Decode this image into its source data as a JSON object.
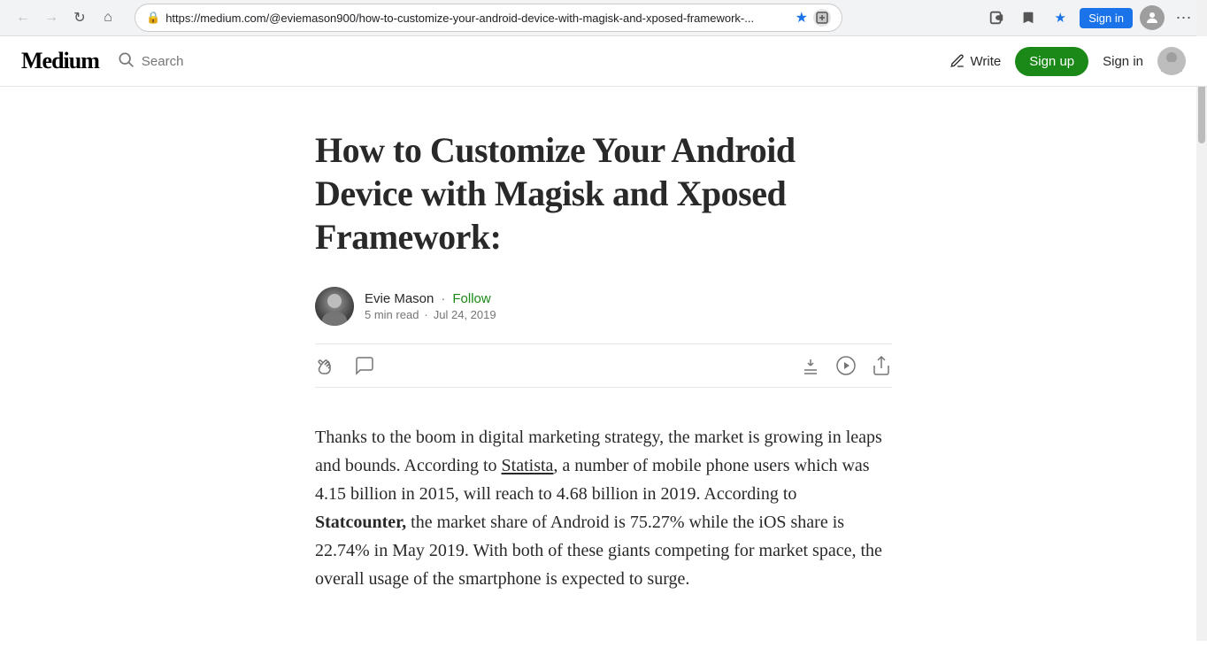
{
  "browser": {
    "url": "https://medium.com/@eviemason900/how-to-customize-your-android-device-with-magisk-and-xposed-framework-...",
    "back_btn": "←",
    "forward_btn": "→",
    "reload_btn": "↻",
    "home_btn": "⌂",
    "lock_icon": "🔒",
    "bookmark_icon": "★",
    "extensions_icon": "🧩",
    "read_list_icon": "📖",
    "star_icon": "★",
    "signin_label": "Sign in",
    "more_icon": "⋯",
    "cursor_tooltip": "cursor"
  },
  "nav": {
    "logo": "Medium",
    "search_label": "Search",
    "write_label": "Write",
    "signup_label": "Sign up",
    "signin_label": "Sign in"
  },
  "article": {
    "title": "How to Customize Your Android Device with Magisk and Xposed Framework:",
    "author": {
      "name": "Evie Mason",
      "follow_label": "Follow",
      "read_time": "5 min read",
      "dot": "·",
      "date": "Jul 24, 2019"
    },
    "actions": {
      "clap_icon": "👏",
      "comment_icon": "💬",
      "save_icon": "🔖",
      "listen_icon": "▶",
      "share_icon": "↗"
    },
    "body_p1": "Thanks to the boom in digital marketing strategy, the market is growing in leaps and bounds. According to Statista, a number of mobile phone users which was 4.15 billion in 2015, will reach to 4.68 billion in 2019. According to Statcounter, the market share of Android is 75.27% while the iOS share is 22.74% in May 2019. With both of these giants competing for market space, the overall usage of the smartphone is expected to surge.",
    "statista_link": "Statista",
    "statcounter_bold": "Statcounter,"
  }
}
